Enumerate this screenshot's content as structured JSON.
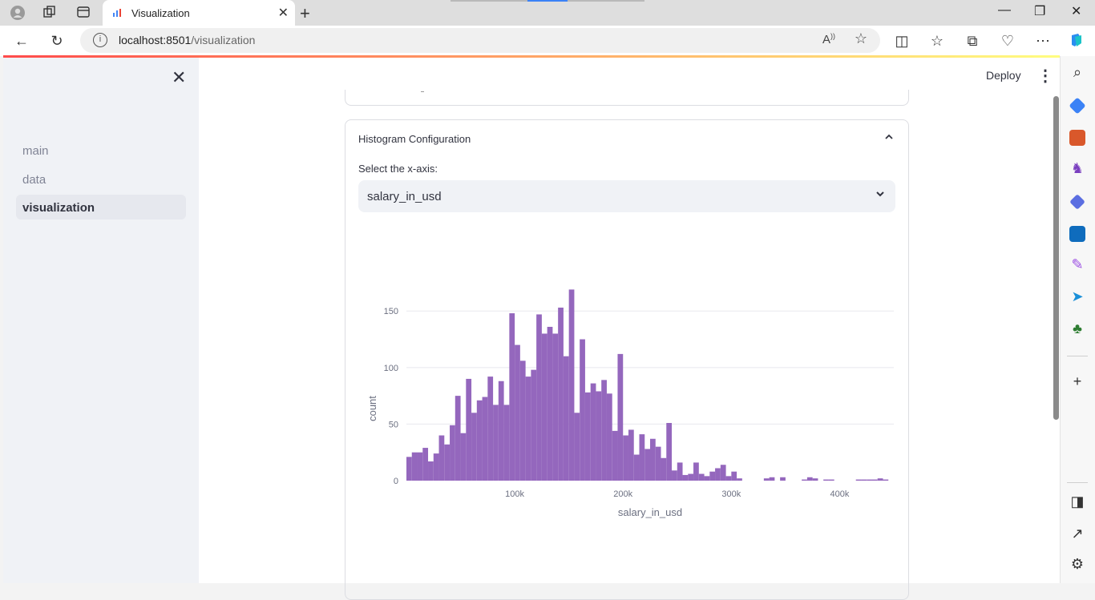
{
  "browser": {
    "tab_title": "Visualization",
    "url_host": "localhost:8501",
    "url_path": "/visualization"
  },
  "sidebar": {
    "items": [
      {
        "label": "main"
      },
      {
        "label": "data"
      },
      {
        "label": "visualization"
      }
    ]
  },
  "header": {
    "deploy_label": "Deploy"
  },
  "card": {
    "title": "Histogram Configuration",
    "select_label": "Select the x-axis:",
    "select_value": "salary_in_usd"
  },
  "colors": {
    "bar": "#9467bd",
    "accent": "#ff4b4b"
  },
  "chart_data": {
    "type": "bar",
    "xlabel": "salary_in_usd",
    "ylabel": "count",
    "x_ticks": [
      "100k",
      "200k",
      "300k",
      "400k"
    ],
    "y_ticks": [
      "0",
      "50",
      "100",
      "150"
    ],
    "xlim": [
      0,
      450000
    ],
    "ylim": [
      0,
      170
    ],
    "bin_width": 5000,
    "bin_start": 0,
    "values": [
      21,
      25,
      25,
      29,
      17,
      24,
      40,
      32,
      49,
      75,
      42,
      90,
      60,
      71,
      74,
      92,
      67,
      88,
      67,
      148,
      120,
      106,
      92,
      98,
      147,
      130,
      136,
      130,
      153,
      110,
      169,
      60,
      125,
      78,
      86,
      79,
      89,
      77,
      44,
      112,
      40,
      45,
      23,
      41,
      28,
      37,
      30,
      20,
      51,
      9,
      16,
      5,
      6,
      16,
      6,
      4,
      8,
      11,
      14,
      4,
      8,
      2,
      0,
      0,
      0,
      0,
      2,
      3,
      0,
      3,
      0,
      0,
      0,
      1,
      3,
      2,
      0,
      1,
      1,
      0,
      0,
      0,
      0,
      1,
      1,
      1,
      1,
      2,
      1,
      0,
      0,
      0,
      0,
      0,
      0,
      1,
      1,
      0,
      1,
      0
    ]
  }
}
